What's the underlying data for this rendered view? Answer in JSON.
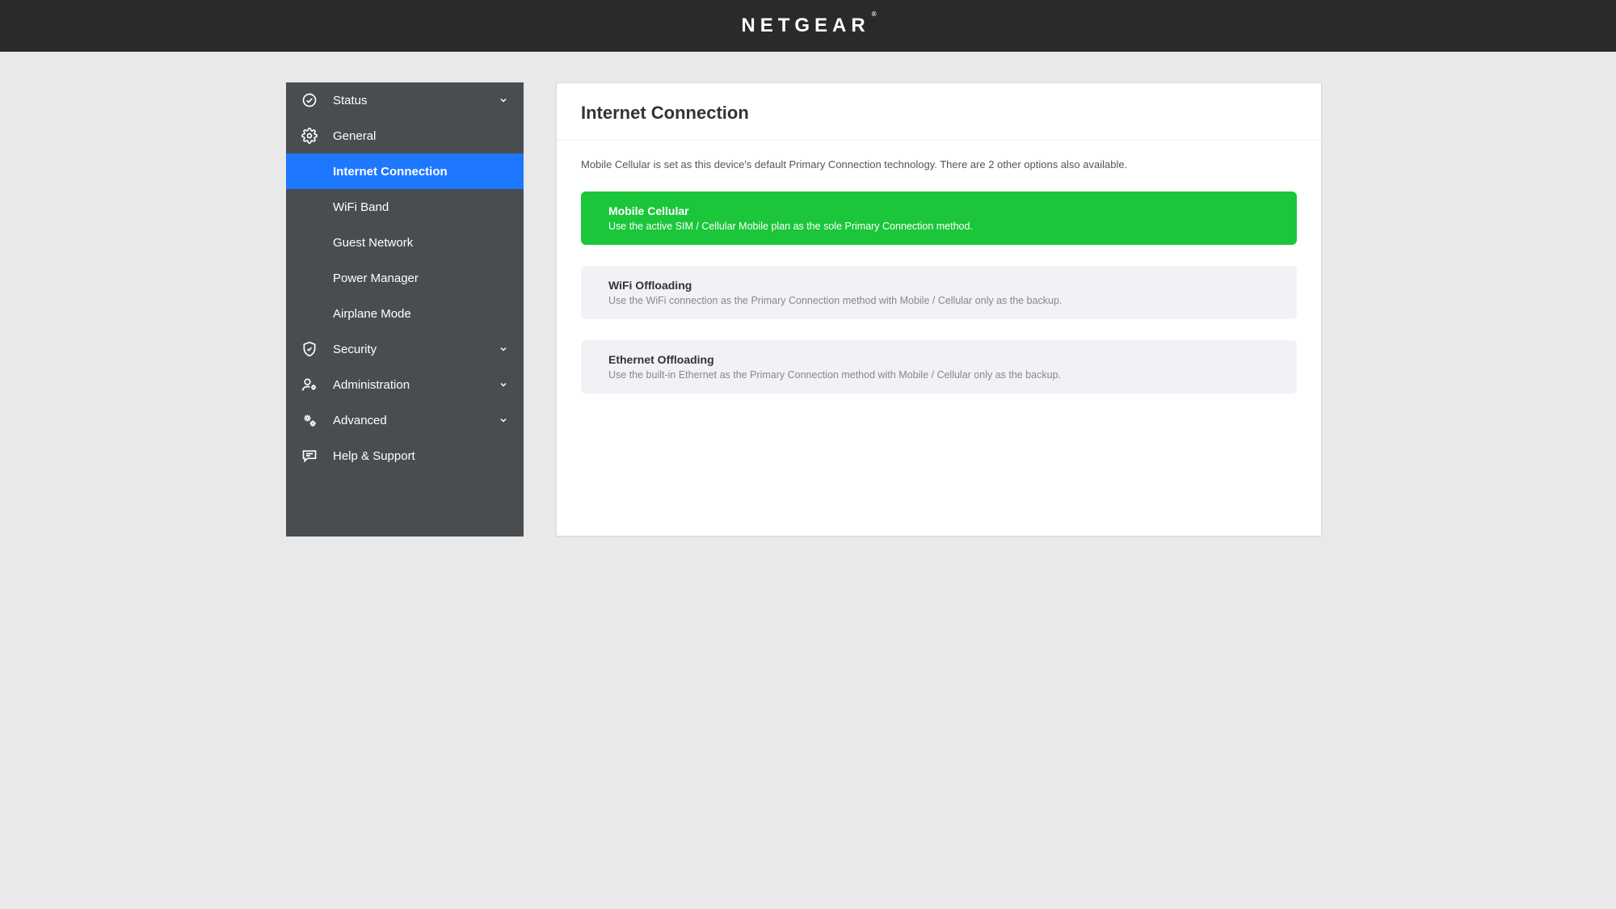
{
  "brand": "NETGEAR",
  "sidebar": {
    "status": "Status",
    "general": "General",
    "general_sub": {
      "internet_connection": "Internet Connection",
      "wifi_band": "WiFi Band",
      "guest_network": "Guest Network",
      "power_manager": "Power Manager",
      "airplane_mode": "Airplane Mode"
    },
    "security": "Security",
    "administration": "Administration",
    "advanced": "Advanced",
    "help_support": "Help & Support"
  },
  "main": {
    "title": "Internet Connection",
    "intro": "Mobile Cellular is set as this device's default Primary Connection technology. There are 2 other options also available.",
    "options": [
      {
        "title": "Mobile Cellular",
        "desc": "Use the active SIM / Cellular Mobile plan as the sole Primary Connection method.",
        "selected": true
      },
      {
        "title": "WiFi Offloading",
        "desc": "Use the WiFi connection as the Primary Connection method with Mobile / Cellular only as the backup.",
        "selected": false
      },
      {
        "title": "Ethernet Offloading",
        "desc": "Use the built-in Ethernet as the Primary Connection method with Mobile / Cellular only as the backup.",
        "selected": false
      }
    ]
  }
}
